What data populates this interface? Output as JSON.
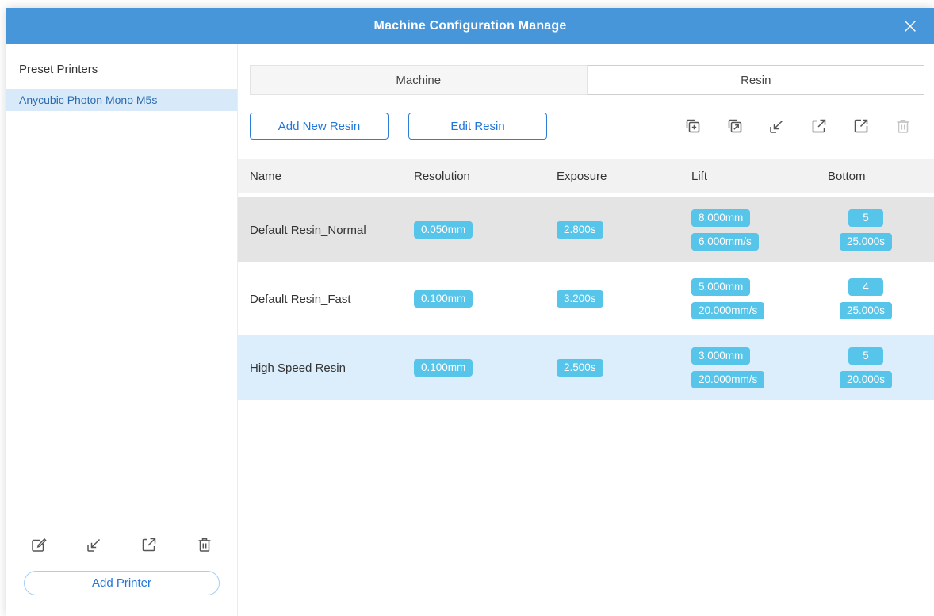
{
  "dialog": {
    "title": "Machine Configuration Manage"
  },
  "sidebar": {
    "heading": "Preset Printers",
    "printers": [
      {
        "name": "Anycubic Photon Mono M5s",
        "selected": true
      }
    ],
    "tool_icons": [
      "edit-icon",
      "import-icon",
      "export-icon",
      "delete-icon"
    ],
    "add_printer_label": "Add Printer"
  },
  "main": {
    "tabs": [
      {
        "label": "Machine",
        "active": false
      },
      {
        "label": "Resin",
        "active": true
      }
    ],
    "actions": {
      "add_new_resin": "Add New Resin",
      "edit_resin": "Edit Resin"
    },
    "tool_icons": [
      "add-copy-icon",
      "duplicate-icon",
      "import-icon",
      "open-external-icon",
      "share-icon",
      "delete-icon"
    ],
    "delete_disabled": true,
    "table": {
      "columns": [
        "Name",
        "Resolution",
        "Exposure",
        "Lift",
        "Bottom"
      ],
      "rows": [
        {
          "name": "Default Resin_Normal",
          "resolution": "0.050mm",
          "exposure": "2.800s",
          "lift": [
            "8.000mm",
            "6.000mm/s"
          ],
          "bottom": [
            "5",
            "25.000s"
          ],
          "state": "selected"
        },
        {
          "name": "Default Resin_Fast",
          "resolution": "0.100mm",
          "exposure": "3.200s",
          "lift": [
            "5.000mm",
            "20.000mm/s"
          ],
          "bottom": [
            "4",
            "25.000s"
          ],
          "state": "plain"
        },
        {
          "name": "High Speed Resin",
          "resolution": "0.100mm",
          "exposure": "2.500s",
          "lift": [
            "3.000mm",
            "20.000mm/s"
          ],
          "bottom": [
            "5",
            "20.000s"
          ],
          "state": "alt"
        }
      ]
    }
  },
  "colors": {
    "header_blue": "#4796da",
    "badge_cyan": "#57c4e9",
    "accent_blue": "#2176d9",
    "sidebar_selected": "#d8eafa",
    "row_selected": "#e4e4e4",
    "row_highlight": "#dcedfb",
    "table_header_bg": "#f2f2f2"
  }
}
